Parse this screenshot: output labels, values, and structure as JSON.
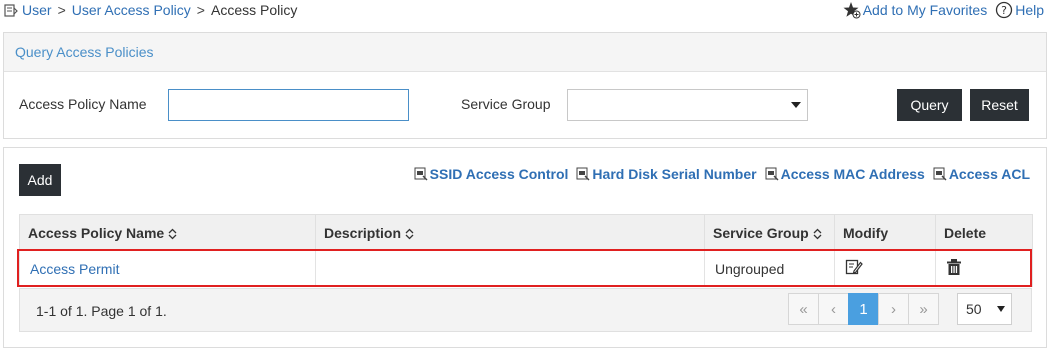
{
  "breadcrumb": {
    "items": [
      "User",
      "User Access Policy"
    ],
    "separator": ">",
    "current": "Access Policy"
  },
  "top_links": {
    "favorites": "Add to My Favorites",
    "help": "Help"
  },
  "query": {
    "title": "Query Access Policies",
    "name_label": "Access Policy Name",
    "name_value": "",
    "group_label": "Service Group",
    "group_value": "",
    "query_button": "Query",
    "reset_button": "Reset"
  },
  "list": {
    "add_button": "Add",
    "links": [
      "SSID Access Control",
      "Hard Disk Serial Number",
      "Access MAC Address",
      "Access ACL"
    ],
    "columns": [
      "Access Policy Name",
      "Description",
      "Service Group",
      "Modify",
      "Delete"
    ],
    "rows": [
      {
        "name": "Access Permit",
        "description": "",
        "group": "Ungrouped"
      }
    ]
  },
  "pager": {
    "info": "1-1 of 1. Page 1 of 1.",
    "first": "«",
    "prev": "‹",
    "page": "1",
    "next": "›",
    "last": "»",
    "page_size": "50"
  },
  "colors": {
    "link": "#2f6fb4",
    "dark_button": "#2b3035",
    "active_page": "#4a9fe0",
    "highlight": "#e02020"
  }
}
